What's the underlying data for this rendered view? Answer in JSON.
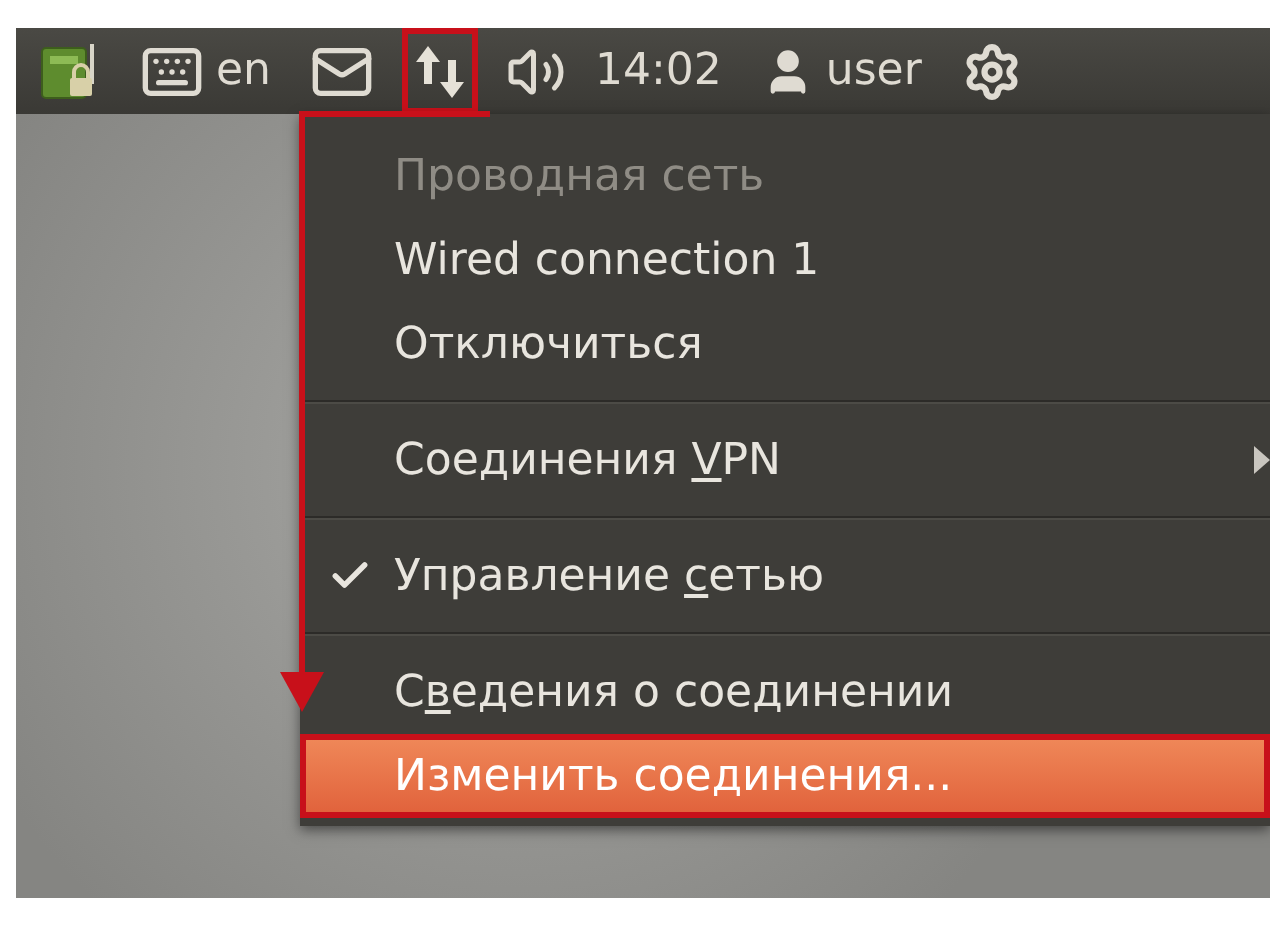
{
  "panel": {
    "keyboard_layout": "en",
    "clock": "14:02",
    "user_name": "user",
    "network_annotated": true
  },
  "menu": {
    "items": [
      {
        "kind": "header",
        "label_before": "Проводная сеть",
        "disabled": true,
        "selected": false,
        "annotated": false
      },
      {
        "kind": "item",
        "label_before": "Wired connection 1",
        "disabled": false,
        "selected": false,
        "annotated": false
      },
      {
        "kind": "item",
        "label_before": "Отключиться",
        "disabled": false,
        "selected": false,
        "annotated": false
      },
      {
        "kind": "separator"
      },
      {
        "kind": "submenu",
        "label_before": "Соединения ",
        "mnemonic": "V",
        "label_after": "PN",
        "disabled": false,
        "selected": false,
        "annotated": false
      },
      {
        "kind": "separator"
      },
      {
        "kind": "check",
        "label_before": "Управление ",
        "mnemonic": "с",
        "label_after": "етью",
        "disabled": false,
        "selected": false,
        "checked": true,
        "annotated": false
      },
      {
        "kind": "separator"
      },
      {
        "kind": "item",
        "label_before": "С",
        "mnemonic": "в",
        "label_after": "едения о соединении",
        "disabled": false,
        "selected": false,
        "annotated": false
      },
      {
        "kind": "item",
        "label_before": "Изменить соединения...",
        "disabled": false,
        "selected": true,
        "annotated": true
      }
    ]
  },
  "annotation_arrow": true
}
